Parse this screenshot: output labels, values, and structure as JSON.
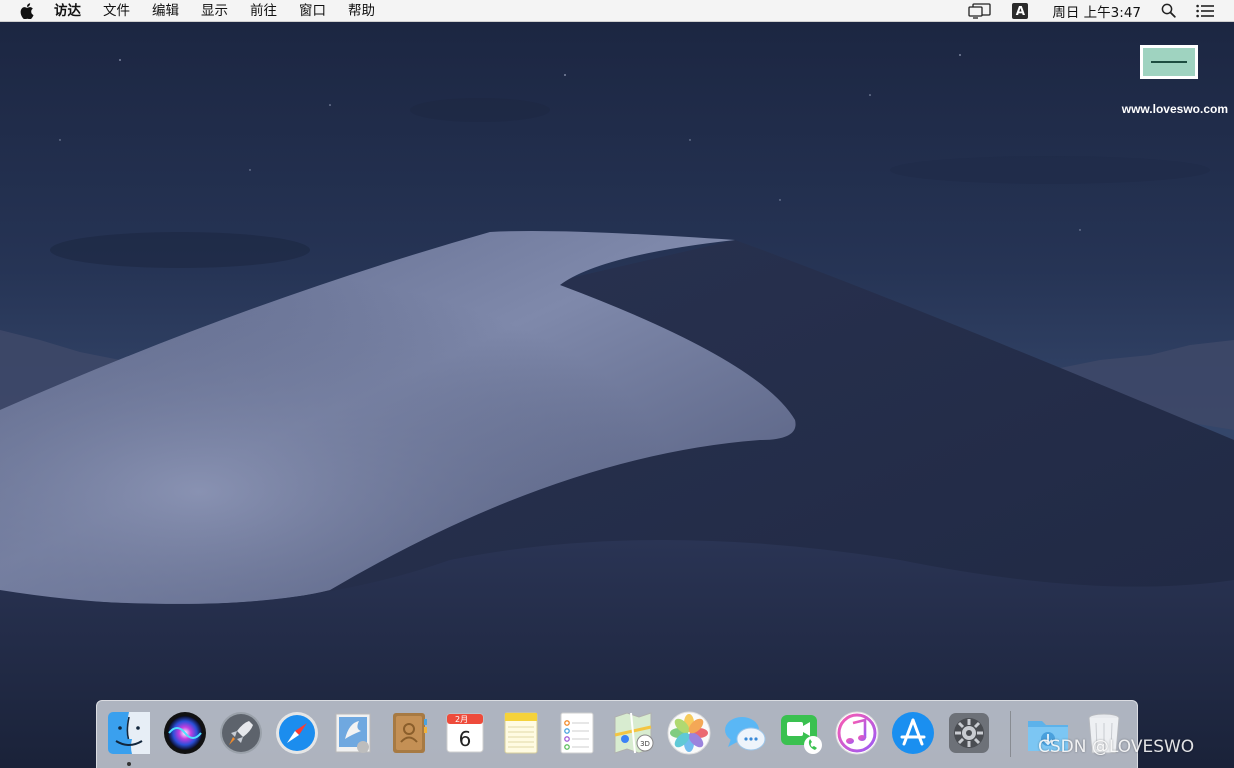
{
  "menubar": {
    "app_name": "访达",
    "items": [
      "文件",
      "编辑",
      "显示",
      "前往",
      "窗口",
      "帮助"
    ],
    "input_source": "A",
    "clock": "周日 上午3:47"
  },
  "watermark": {
    "caption": "www.loveswo.com",
    "bottom_text": "CSDN @LOVESWO"
  },
  "dock": {
    "apps": [
      {
        "name": "Finder",
        "icon": "finder-icon",
        "running": true
      },
      {
        "name": "Siri",
        "icon": "siri-icon"
      },
      {
        "name": "Launchpad",
        "icon": "launchpad-icon"
      },
      {
        "name": "Safari",
        "icon": "safari-icon"
      },
      {
        "name": "Mail",
        "icon": "mail-icon"
      },
      {
        "name": "Contacts",
        "icon": "contacts-icon"
      },
      {
        "name": "Calendar",
        "icon": "calendar-icon",
        "month": "2月",
        "day": "6"
      },
      {
        "name": "Notes",
        "icon": "notes-icon"
      },
      {
        "name": "Reminders",
        "icon": "reminders-icon"
      },
      {
        "name": "Maps",
        "icon": "maps-icon",
        "badge": "3D"
      },
      {
        "name": "Photos",
        "icon": "photos-icon"
      },
      {
        "name": "Messages",
        "icon": "messages-icon"
      },
      {
        "name": "FaceTime",
        "icon": "facetime-icon"
      },
      {
        "name": "iTunes",
        "icon": "itunes-icon"
      },
      {
        "name": "App Store",
        "icon": "appstore-icon"
      },
      {
        "name": "System Preferences",
        "icon": "system-preferences-icon"
      },
      {
        "name": "Downloads",
        "icon": "downloads-folder-icon"
      },
      {
        "name": "Trash",
        "icon": "trash-icon"
      }
    ]
  },
  "colors": {
    "sky_top": "#17213a",
    "sky_mid": "#2c3a5a",
    "dune_light": "#7c86a6",
    "dune_dark": "#222c48",
    "menubar_bg": "#f4f4f4"
  }
}
